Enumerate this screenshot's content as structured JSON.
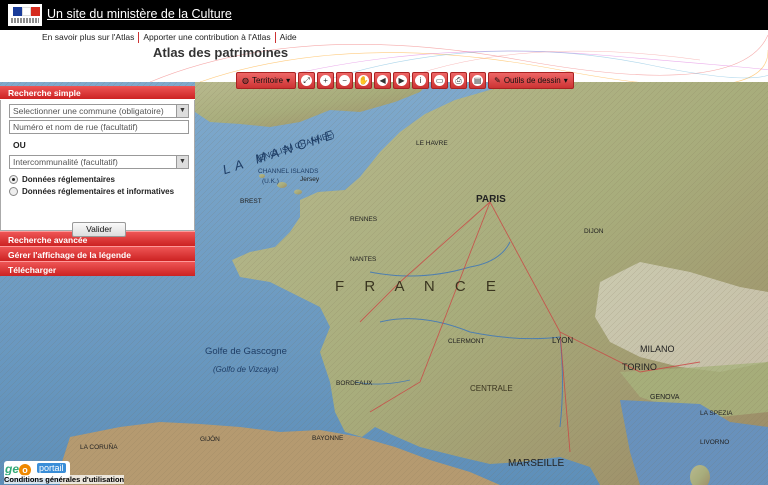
{
  "topbar": {
    "title": "Un site du ministère de la Culture"
  },
  "nav": {
    "links": [
      "En savoir plus sur l'Atlas",
      "Apporter une contribution à l'Atlas",
      "Aide"
    ]
  },
  "header": {
    "title": "Atlas des patrimoines"
  },
  "toolbar": {
    "territoire_label": "Territoire",
    "outils_label": "Outils de dessin"
  },
  "panel": {
    "recherche_simple": "Recherche simple",
    "commune_placeholder": "Selectionner une commune (obligatoire)",
    "rue_placeholder": "Numéro et nom de rue (facultatif)",
    "ou": "OU",
    "interco_placeholder": "Intercommunalité (facultatif)",
    "radio1": "Données réglementaires",
    "radio2": "Données réglementaires et informatives",
    "valider": "Valider",
    "recherche_avancee": "Recherche avancée",
    "gerer_legende": "Gérer l'affichage de la légende",
    "telecharger": "Télécharger"
  },
  "map": {
    "labels": {
      "la_manche": "LA MANCHE",
      "english_channel": "(ENGLISH CHANNEL)",
      "channel_islands": "CHANNEL ISLANDS",
      "uk": "(U.K.)",
      "jersey": "Jersey",
      "paris": "PARIS",
      "france": "F R A N C E",
      "golfe_gascogne": "Golfe de Gascogne",
      "golfo_vizcaya": "(Golfo de Vizcaya)",
      "bordeaux": "BORDEAUX",
      "lyon": "LYON",
      "milano": "MILANO",
      "torino": "TORINO",
      "genova": "GENOVA",
      "marseille": "MARSEILLE",
      "nantes": "NANTES",
      "rennes": "RENNES",
      "brest": "BREST",
      "clermont": "CLERMONT",
      "dijon": "DIJON",
      "bayonne": "BAYONNE",
      "la_coruna": "LA CORUÑA",
      "gijon": "GIJÓN",
      "la_spezia": "LA SPEZIA",
      "livorno": "LIVORNO",
      "centrale": "CENTRALE",
      "le_havre": "LE HAVRE"
    }
  },
  "footer": {
    "geo": "ge",
    "portail": "portail",
    "cgu": "Conditions générales d'utilisation"
  },
  "colors": {
    "accent": "#cc2222",
    "sea": "#6f9ec4",
    "land": "#a9b487"
  }
}
